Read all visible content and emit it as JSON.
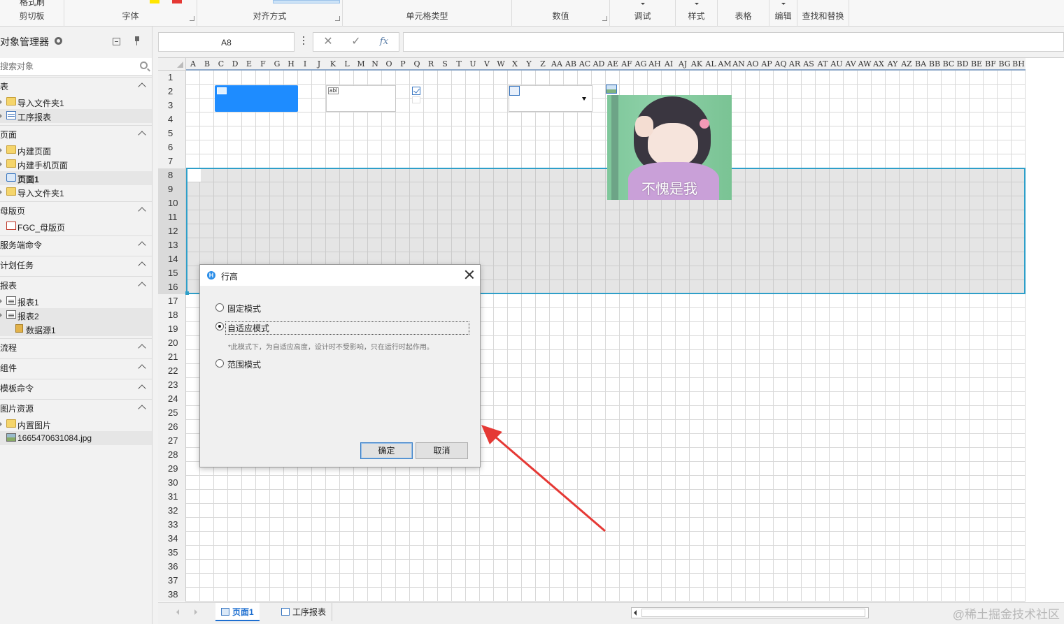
{
  "ribbon": {
    "groups": [
      {
        "label": "剪切板",
        "has_launcher": false,
        "top_label": "格式刷"
      },
      {
        "label": "字体",
        "has_launcher": true
      },
      {
        "label": "对齐方式",
        "has_launcher": true
      },
      {
        "label": "单元格类型",
        "has_launcher": false
      },
      {
        "label": "数值",
        "has_launcher": true
      },
      {
        "label": "调试",
        "has_launcher": false
      },
      {
        "label": "样式",
        "has_launcher": false
      },
      {
        "label": "表格",
        "has_launcher": false
      },
      {
        "label": "编辑",
        "has_launcher": false
      },
      {
        "label": "查找和替换",
        "has_launcher": false
      }
    ]
  },
  "object_manager": {
    "title": "对象管理器",
    "search_placeholder": "搜索对象",
    "sections": {
      "tables": {
        "title": "表",
        "items": [
          "导入文件夹1",
          "工序报表"
        ]
      },
      "pages": {
        "title": "页面",
        "items": [
          "内建页面",
          "内建手机页面",
          "页面1",
          "导入文件夹1"
        ]
      },
      "master": {
        "title": "母版页",
        "items": [
          "FGC_母版页"
        ]
      },
      "server_cmd": {
        "title": "服务端命令"
      },
      "schedule": {
        "title": "计划任务"
      },
      "reports": {
        "title": "报表",
        "items": [
          "报表1",
          "报表2",
          "数据源1"
        ]
      },
      "flow": {
        "title": "流程"
      },
      "components": {
        "title": "组件"
      },
      "template_cmd": {
        "title": "模板命令"
      },
      "images": {
        "title": "图片资源",
        "items": [
          "内置图片",
          "1665470631084.jpg"
        ]
      }
    }
  },
  "formula_bar": {
    "name_box": "A8",
    "fx_label": "fx",
    "formula": ""
  },
  "grid": {
    "columns": [
      "A",
      "B",
      "C",
      "D",
      "E",
      "F",
      "G",
      "H",
      "I",
      "J",
      "K",
      "L",
      "M",
      "N",
      "O",
      "P",
      "Q",
      "R",
      "S",
      "T",
      "U",
      "V",
      "W",
      "X",
      "Y",
      "Z",
      "AA",
      "AB",
      "AC",
      "AD",
      "AE",
      "AF",
      "AG",
      "AH",
      "AI",
      "AJ",
      "AK",
      "AL",
      "AM",
      "AN",
      "AO",
      "AP",
      "AQ",
      "AR",
      "AS",
      "AT",
      "AU",
      "AV",
      "AW",
      "AX",
      "AY",
      "AZ",
      "BA",
      "BB",
      "BC",
      "BD",
      "BE",
      "BF",
      "BG",
      "BH"
    ],
    "selected_rows": [
      8,
      16
    ],
    "image_caption": "不愧是我",
    "textbox_badge": "abl"
  },
  "dialog": {
    "title": "行高",
    "options": [
      "固定模式",
      "自适应模式",
      "范围模式"
    ],
    "selected_option": "自适应模式",
    "note": "*此模式下，为自适应高度，设计时不受影响，只在运行时起作用。",
    "ok": "确定",
    "cancel": "取消"
  },
  "tabs": [
    "页面1",
    "工序报表"
  ],
  "active_tab": "页面1",
  "watermark": "@稀土掘金技术社区",
  "colors": {
    "accent": "#1e8cff",
    "selection_border": "#2e9fc9",
    "annotation_arrow": "#e53935"
  }
}
